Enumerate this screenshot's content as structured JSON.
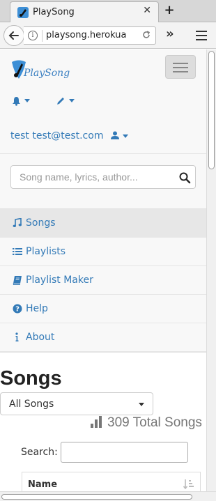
{
  "browser": {
    "tab_title": "PlaySong",
    "tab_close": "✕",
    "new_tab": "+",
    "url": "playsong.herokua",
    "overflow": "»"
  },
  "app": {
    "logo_text": "PlaySong",
    "user_label": "test test@test.com"
  },
  "search": {
    "placeholder": "Song name, lyrics, author..."
  },
  "nav": {
    "items": [
      {
        "label": "Songs",
        "icon": "music-icon",
        "active": true
      },
      {
        "label": "Playlists",
        "icon": "list-icon",
        "active": false
      },
      {
        "label": "Playlist Maker",
        "icon": "book-icon",
        "active": false
      },
      {
        "label": "Help",
        "icon": "question-circle-icon",
        "active": false
      },
      {
        "label": "About",
        "icon": "info-icon",
        "active": false
      }
    ]
  },
  "content": {
    "title": "Songs",
    "filter_selected": "All Songs",
    "total_text": "309 Total Songs",
    "table_search_label": "Search:",
    "table_columns": [
      "Name"
    ]
  },
  "colors": {
    "link": "#337ab7",
    "sidebar_bg": "#f8f8f8",
    "active_bg": "#e7e7e7"
  }
}
